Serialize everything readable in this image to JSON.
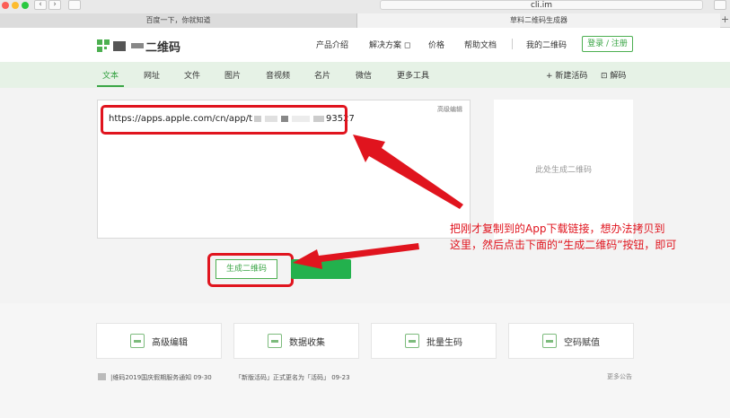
{
  "browser": {
    "address": "cli.im",
    "tabs": [
      "百度一下，你就知道",
      "草料二维码生成器"
    ],
    "new_tab": "+"
  },
  "header": {
    "logo_text": "二维码",
    "nav": [
      "产品介绍",
      "解决方案 ◻",
      "价格",
      "帮助文档",
      "我的二维码"
    ],
    "login": "登录 / 注册"
  },
  "toolbar": {
    "tabs": [
      "文本",
      "网址",
      "文件",
      "图片",
      "音视频",
      "名片",
      "微信",
      "更多工具"
    ],
    "right": [
      "+ 新建活码",
      "⊡ 解码"
    ]
  },
  "editor": {
    "advanced": "高级编辑",
    "url_prefix": "https://apps.apple.com/cn/app/t",
    "url_suffix": "93527"
  },
  "preview": {
    "placeholder": "此处生成二维码"
  },
  "generate_button": "生成二维码",
  "annotation": {
    "line1": "把刚才复制到的App下载链接，想办法拷贝到",
    "line2": "这里，然后点击下面的“生成二维码”按钮，即可"
  },
  "cards": [
    "高级编辑",
    "数据收集",
    "批量生码",
    "空码赋值"
  ],
  "notices": [
    "|维码2019国庆假期服务通知  09-30",
    "「新版活码」正式更名为「活码」  09-23"
  ],
  "more_notices": "更多公告",
  "colors": {
    "brand_green": "#3aa545",
    "annotation_red": "#e0141e"
  }
}
